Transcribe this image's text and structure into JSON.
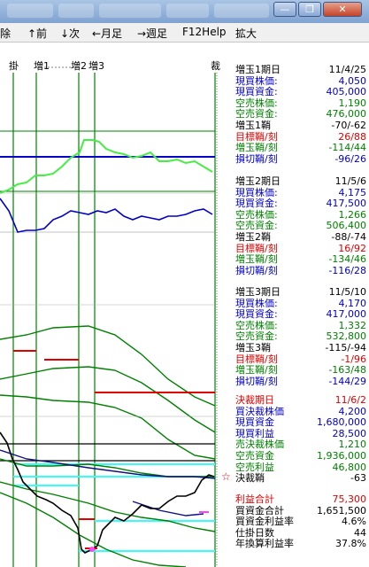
{
  "window": {
    "minimize_glyph": "—",
    "restore_glyph": "❐",
    "close_glyph": "✕"
  },
  "menu": [
    {
      "label": "除"
    },
    {
      "label": "↑前"
    },
    {
      "label": "↓次"
    },
    {
      "label": "←月足"
    },
    {
      "label": "→週足"
    },
    {
      "label": "F12Help"
    },
    {
      "label": "拡大"
    }
  ],
  "chart_markers": {
    "m1": "掛",
    "m2": "増1",
    "m3": "増2",
    "m4": "増3",
    "m5": "裁"
  },
  "chart_annotation": "☆♪♪",
  "colors": {
    "black": "#000000",
    "blue": "#0000c8",
    "green": "#008000",
    "red": "#e00000",
    "lime": "#44ee44",
    "cyan": "#33ffff",
    "magenta": "#ff44ff",
    "navy": "#101080"
  },
  "panel": {
    "sections": [
      {
        "rows": [
          {
            "label": "増玉1期日",
            "value": "11/4/25",
            "color": "black"
          },
          {
            "label": "現買株価:",
            "value": "4,050",
            "color": "blue"
          },
          {
            "label": "現買資金:",
            "value": "405,000",
            "color": "blue"
          },
          {
            "label": "空売株価:",
            "value": "1,190",
            "color": "green"
          },
          {
            "label": "空売資金:",
            "value": "476,000",
            "color": "green"
          },
          {
            "label": "増玉1鞘",
            "value": "-70/-62",
            "color": "black"
          },
          {
            "label": "目標鞘/刻",
            "value": "26/88",
            "color": "red"
          },
          {
            "label": "増玉鞘/刻",
            "value": "-114/44",
            "color": "green"
          },
          {
            "label": "損切鞘/刻",
            "value": "-96/26",
            "color": "blue"
          }
        ]
      },
      {
        "rows": [
          {
            "label": "増玉2期日",
            "value": "11/5/6",
            "color": "black"
          },
          {
            "label": "現買株価:",
            "value": "4,175",
            "color": "blue"
          },
          {
            "label": "現買資金:",
            "value": "417,500",
            "color": "blue"
          },
          {
            "label": "空売株価:",
            "value": "1,266",
            "color": "green"
          },
          {
            "label": "空売資金:",
            "value": "506,400",
            "color": "green"
          },
          {
            "label": "増玉2鞘",
            "value": "-88/-74",
            "color": "black"
          },
          {
            "label": "目標鞘/刻",
            "value": "16/92",
            "color": "red"
          },
          {
            "label": "増玉鞘/刻",
            "value": "-134/46",
            "color": "green"
          },
          {
            "label": "損切鞘/刻",
            "value": "-116/28",
            "color": "blue"
          }
        ]
      },
      {
        "rows": [
          {
            "label": "増玉3期日",
            "value": "11/5/10",
            "color": "black"
          },
          {
            "label": "現買株価:",
            "value": "4,170",
            "color": "blue"
          },
          {
            "label": "現買資金:",
            "value": "417,000",
            "color": "blue"
          },
          {
            "label": "空売株価:",
            "value": "1,332",
            "color": "green"
          },
          {
            "label": "空売資金:",
            "value": "532,800",
            "color": "green"
          },
          {
            "label": "増玉3鞘",
            "value": "-115/-94",
            "color": "black"
          },
          {
            "label": "目標鞘/刻",
            "value": "-1/96",
            "color": "red"
          },
          {
            "label": "増玉鞘/刻",
            "value": "-163/48",
            "color": "green"
          },
          {
            "label": "損切鞘/刻",
            "value": "-144/29",
            "color": "blue"
          }
        ]
      },
      {
        "rows": [
          {
            "label": "決裁期日",
            "value": "11/6/2",
            "color": "red"
          },
          {
            "label": "買決裁株価",
            "value": "4,200",
            "color": "blue"
          },
          {
            "label": "現買資金",
            "value": "1,680,000",
            "color": "blue"
          },
          {
            "label": "現買利益",
            "value": "28,500",
            "color": "blue"
          },
          {
            "label": "売決裁株価",
            "value": "1,210",
            "color": "green"
          },
          {
            "label": "空売資金",
            "value": "1,936,000",
            "color": "green"
          },
          {
            "label": "空売利益",
            "value": "46,800",
            "color": "green"
          },
          {
            "label": "決裁鞘",
            "value": "-63",
            "color": "black"
          }
        ]
      },
      {
        "rows": [
          {
            "label": "利益合計",
            "value": "75,300",
            "color": "red"
          },
          {
            "label": "買資金合計",
            "value": "1,651,500",
            "color": "black"
          },
          {
            "label": "買資金利益率",
            "value": "4.6%",
            "color": "black"
          },
          {
            "label": "仕掛日数",
            "value": "44",
            "color": "black"
          },
          {
            "label": "年換算利益率",
            "value": "37.8%",
            "color": "black"
          }
        ]
      }
    ]
  }
}
